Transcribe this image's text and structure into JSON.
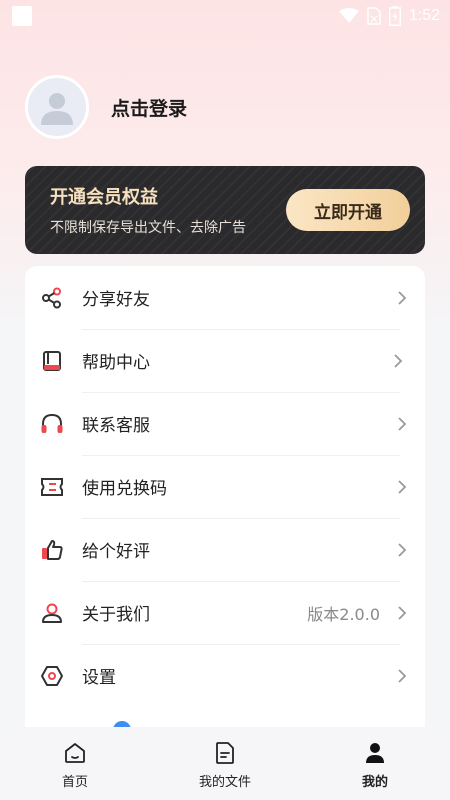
{
  "status_bar": {
    "time": "1:52"
  },
  "profile": {
    "login_text": "点击登录"
  },
  "vip": {
    "title": "开通会员权益",
    "subtitle": "不限制保存导出文件、去除广告",
    "button_label": "立即开通"
  },
  "menu": {
    "items": [
      {
        "label": "分享好友",
        "icon": "share-icon",
        "value": ""
      },
      {
        "label": "帮助中心",
        "icon": "book-icon",
        "value": ""
      },
      {
        "label": "联系客服",
        "icon": "headset-icon",
        "value": ""
      },
      {
        "label": "使用兑换码",
        "icon": "ticket-icon",
        "value": ""
      },
      {
        "label": "给个好评",
        "icon": "thumbs-up-icon",
        "value": ""
      },
      {
        "label": "关于我们",
        "icon": "user-icon",
        "value": "版本2.0.0"
      },
      {
        "label": "设置",
        "icon": "settings-icon",
        "value": ""
      }
    ]
  },
  "bottom_nav": {
    "items": [
      {
        "label": "首页",
        "icon": "home-icon"
      },
      {
        "label": "我的文件",
        "icon": "document-icon"
      },
      {
        "label": "我的",
        "icon": "person-icon"
      }
    ],
    "active": "我的"
  },
  "colors": {
    "accent_red": "#f0474f",
    "vip_gold": "#f6e0bd",
    "card_dark": "#2a2a2c"
  }
}
